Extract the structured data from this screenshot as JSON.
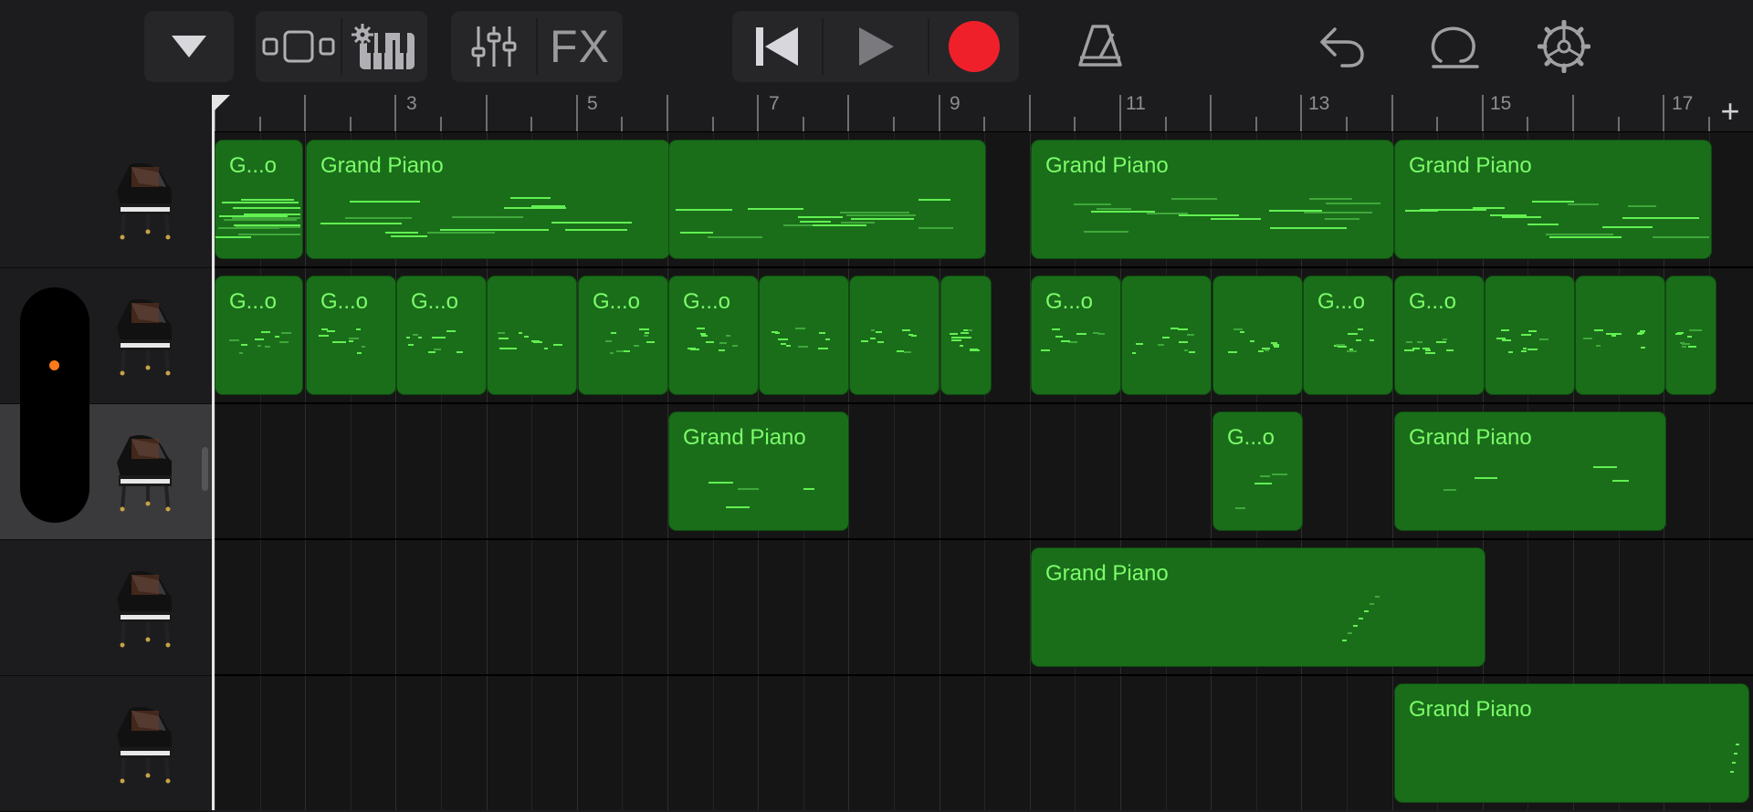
{
  "toolbar": {
    "fx_label": "FX"
  },
  "ruler": {
    "bar_numbers": [
      "3",
      "5",
      "7",
      "9",
      "11",
      "13",
      "15",
      "17"
    ],
    "add_label": "+"
  },
  "colors": {
    "region_fill": "#1a6e1a",
    "region_text": "#7cfc6a",
    "record": "#f0202a",
    "volume_dot": "#ff7a1a"
  },
  "tracks": [
    {
      "instrument": "Grand Piano",
      "selected": false,
      "regions": [
        {
          "label": "G...o"
        },
        {
          "label": "Grand Piano"
        },
        {
          "label": ""
        },
        {
          "label": "Grand Piano"
        },
        {
          "label": "Grand Piano"
        }
      ]
    },
    {
      "instrument": "Grand Piano",
      "selected": false,
      "regions": [
        {
          "label": "G...o"
        },
        {
          "label": "G...o"
        },
        {
          "label": "G...o"
        },
        {
          "label": ""
        },
        {
          "label": "G...o"
        },
        {
          "label": "G...o"
        },
        {
          "label": ""
        },
        {
          "label": ""
        },
        {
          "label": ""
        },
        {
          "label": "G...o"
        },
        {
          "label": ""
        },
        {
          "label": ""
        },
        {
          "label": "G...o"
        },
        {
          "label": "G...o"
        },
        {
          "label": ""
        },
        {
          "label": ""
        },
        {
          "label": ""
        }
      ]
    },
    {
      "instrument": "Grand Piano",
      "selected": true,
      "regions": [
        {
          "label": "Grand Piano"
        },
        {
          "label": "G...o"
        },
        {
          "label": "Grand Piano"
        }
      ]
    },
    {
      "instrument": "Grand Piano",
      "selected": false,
      "regions": [
        {
          "label": "Grand Piano"
        }
      ]
    },
    {
      "instrument": "Grand Piano",
      "selected": false,
      "regions": [
        {
          "label": "Grand Piano"
        }
      ]
    }
  ]
}
